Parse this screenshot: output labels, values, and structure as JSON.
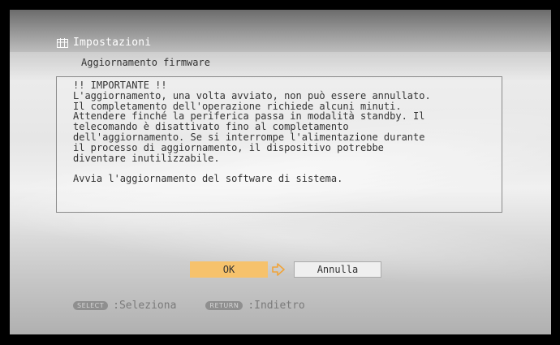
{
  "header": {
    "title": "Impostazioni",
    "title_icon": "settings-grid-icon"
  },
  "subtitle": "Aggiornamento firmware",
  "message": {
    "lines": [
      "!! IMPORTANTE !!",
      "L'aggiornamento, una volta avviato, non può essere annullato.",
      "Il completamento dell'operazione richiede alcuni minuti.",
      "Attendere finché la periferica passa in modalità standby. Il",
      "telecomando è disattivato fino al completamento",
      "dell'aggiornamento. Se si interrompe l'alimentazione durante",
      "il processo di aggiornamento, il dispositivo potrebbe",
      "diventare inutilizzabile."
    ],
    "prompt": "Avvia l'aggiornamento del software di sistema."
  },
  "buttons": {
    "ok": "OK",
    "cancel": "Annulla",
    "focus_indicator_icon": "arrow-right-icon"
  },
  "footer": {
    "select_key": "SELECT",
    "select_label": ":Seleziona",
    "return_key": "RETURN",
    "return_label": ":Indietro"
  },
  "colors": {
    "focused_button": "#f6c26c",
    "text": "#333333",
    "header_text": "#ffffff"
  }
}
